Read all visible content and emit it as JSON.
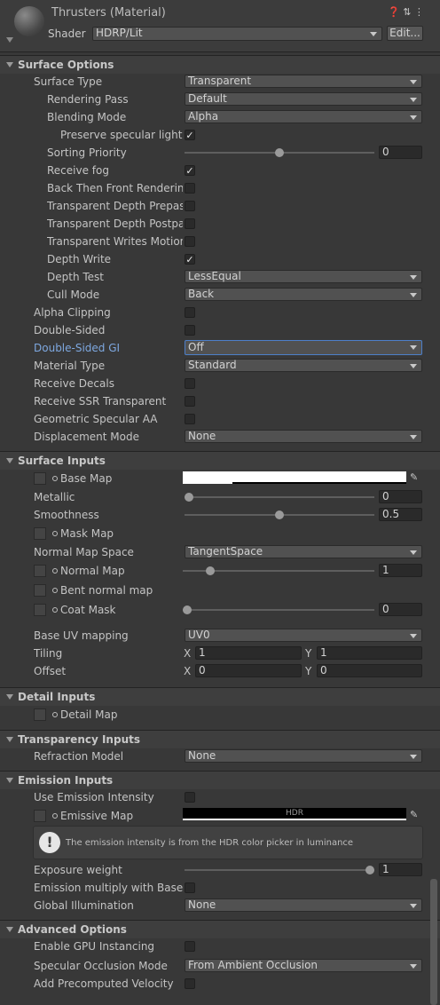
{
  "header": {
    "title": "Thrusters (Material)",
    "shader_label": "Shader",
    "shader_value": "HDRP/Lit",
    "edit_button": "Edit...",
    "icons": [
      "help-icon",
      "preset-icon",
      "more-icon"
    ]
  },
  "surface_options": {
    "title": "Surface Options",
    "surface_type": {
      "label": "Surface Type",
      "value": "Transparent"
    },
    "rendering_pass": {
      "label": "Rendering Pass",
      "value": "Default"
    },
    "blending_mode": {
      "label": "Blending Mode",
      "value": "Alpha"
    },
    "preserve_specular": {
      "label": "Preserve specular lightin",
      "checked": true
    },
    "sorting_priority": {
      "label": "Sorting Priority",
      "value": "0"
    },
    "receive_fog": {
      "label": "Receive fog",
      "checked": true
    },
    "back_then_front": {
      "label": "Back Then Front Rendering",
      "checked": false
    },
    "depth_prepass": {
      "label": "Transparent Depth Prepass",
      "checked": false
    },
    "depth_postpass": {
      "label": "Transparent Depth Postpas",
      "checked": false
    },
    "writes_motion": {
      "label": "Transparent Writes Motion V",
      "checked": false
    },
    "depth_write": {
      "label": "Depth Write",
      "checked": true
    },
    "depth_test": {
      "label": "Depth Test",
      "value": "LessEqual"
    },
    "cull_mode": {
      "label": "Cull Mode",
      "value": "Back"
    },
    "alpha_clipping": {
      "label": "Alpha Clipping",
      "checked": false
    },
    "double_sided": {
      "label": "Double-Sided",
      "checked": false
    },
    "double_sided_gi": {
      "label": "Double-Sided GI",
      "value": "Off"
    },
    "material_type": {
      "label": "Material Type",
      "value": "Standard"
    },
    "receive_decals": {
      "label": "Receive Decals",
      "checked": false
    },
    "receive_ssr": {
      "label": "Receive SSR Transparent",
      "checked": false
    },
    "geometric_aa": {
      "label": "Geometric Specular AA",
      "checked": false
    },
    "displacement_mode": {
      "label": "Displacement Mode",
      "value": "None"
    }
  },
  "surface_inputs": {
    "title": "Surface Inputs",
    "base_map": {
      "label": "Base Map"
    },
    "metallic": {
      "label": "Metallic",
      "value": "0",
      "fraction": 0
    },
    "smoothness": {
      "label": "Smoothness",
      "value": "0.5",
      "fraction": 0.5
    },
    "mask_map": {
      "label": "Mask Map"
    },
    "normal_map_space": {
      "label": "Normal Map Space",
      "value": "TangentSpace"
    },
    "normal_map": {
      "label": "Normal Map",
      "value": "1",
      "fraction": 0.125
    },
    "bent_normal_map": {
      "label": "Bent normal map"
    },
    "coat_mask": {
      "label": "Coat Mask",
      "value": "0",
      "fraction": 0
    },
    "base_uv_mapping": {
      "label": "Base UV mapping",
      "value": "UV0"
    },
    "tiling": {
      "label": "Tiling",
      "x_label": "X",
      "x": "1",
      "y_label": "Y",
      "y": "1"
    },
    "offset": {
      "label": "Offset",
      "x_label": "X",
      "x": "0",
      "y_label": "Y",
      "y": "0"
    }
  },
  "detail_inputs": {
    "title": "Detail Inputs",
    "detail_map": {
      "label": "Detail Map"
    }
  },
  "transparency_inputs": {
    "title": "Transparency Inputs",
    "refraction_model": {
      "label": "Refraction Model",
      "value": "None"
    }
  },
  "emission_inputs": {
    "title": "Emission Inputs",
    "use_intensity": {
      "label": "Use Emission Intensity",
      "checked": false
    },
    "emissive_map": {
      "label": "Emissive Map",
      "hdr_tag": "HDR"
    },
    "help_text": "The emission intensity is from the HDR color picker in luminance",
    "exposure_weight": {
      "label": "Exposure weight",
      "value": "1",
      "fraction": 1
    },
    "multiply_base": {
      "label": "Emission multiply with Base",
      "checked": false
    },
    "global_illumination": {
      "label": "Global Illumination",
      "value": "None"
    }
  },
  "advanced_options": {
    "title": "Advanced Options",
    "gpu_instancing": {
      "label": "Enable GPU Instancing",
      "checked": false
    },
    "specular_occlusion": {
      "label": "Specular Occlusion Mode",
      "value": "From Ambient Occlusion"
    },
    "precomputed_velocity": {
      "label": "Add Precomputed Velocity",
      "checked": false
    }
  },
  "colors": {
    "background": "#383838",
    "highlight_label": "#7ea8e0",
    "focus_border": "#4d7fc9"
  }
}
